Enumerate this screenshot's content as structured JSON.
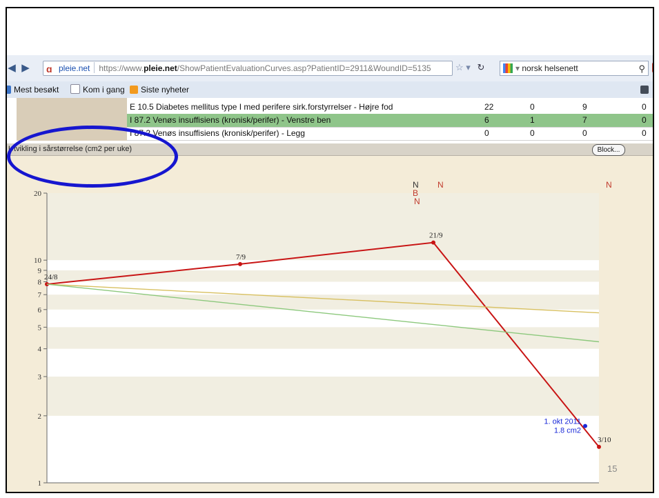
{
  "browser": {
    "site_name": "pleie.net",
    "url_prefix": "https://www.",
    "url_domain": "pleie.net",
    "url_path": "/ShowPatientEvaluationCurves.asp?PatientID=2911&WoundID=5135",
    "search_text": "norsk helsenett",
    "bookmarks": [
      {
        "label": "Mest besøkt"
      },
      {
        "label": "Kom i gang"
      },
      {
        "label": "Siste nyheter"
      }
    ]
  },
  "diagnoses": [
    {
      "label": "E 10.5 Diabetes mellitus type I med perifere sirk.forstyrrelser - Højre fod",
      "c1": "22",
      "c2": "0",
      "c3": "9",
      "c4": "0",
      "selected": false
    },
    {
      "label": "I 87.2 Venøs insuffisiens (kronisk/perifer) - Venstre ben",
      "c1": "6",
      "c2": "1",
      "c3": "7",
      "c4": "0",
      "selected": true
    },
    {
      "label": "I 87.2 Venøs insuffisiens (kronisk/perifer) - Legg",
      "c1": "0",
      "c2": "0",
      "c3": "0",
      "c4": "0",
      "selected": false
    }
  ],
  "panel": {
    "title": "Utvikling i sårstørrelse (cm2 per uke)",
    "block_button": "Block..."
  },
  "chart_data": {
    "type": "line",
    "yscale": "log",
    "ylim": [
      1,
      20
    ],
    "yticks": [
      "1",
      "2",
      "3",
      "4",
      "5",
      "6",
      "7",
      "8",
      "9",
      "10",
      "20"
    ],
    "series": [
      {
        "color": "#c81414",
        "points": [
          {
            "x": "24/8",
            "y": 7.8
          },
          {
            "x": "7/9",
            "y": 9.6
          },
          {
            "x": "21/9",
            "y": 12.0
          },
          {
            "x": "3/10",
            "y": 1.45
          }
        ]
      },
      {
        "color": "#d8c060",
        "points": [
          {
            "x": "24/8",
            "y": 7.8
          },
          {
            "x": "end",
            "y": 5.8
          }
        ]
      },
      {
        "color": "#8cc87c",
        "points": [
          {
            "x": "24/8",
            "y": 7.8
          },
          {
            "x": "end",
            "y": 4.3
          }
        ]
      }
    ],
    "highlight": {
      "label": "1. okt 2011",
      "value": "1.8 cm2",
      "y": 1.8,
      "color": "#1a2ad8"
    },
    "markers": [
      {
        "text": "N",
        "color": "#333333",
        "x": "21/9-left"
      },
      {
        "text": "B",
        "color": "#c0392b",
        "x": "21/9-left"
      },
      {
        "text": "N",
        "color": "#c0392b",
        "x": "21/9-left"
      },
      {
        "text": "N",
        "color": "#c0392b",
        "x": "21/9"
      },
      {
        "text": "N",
        "color": "#c0392b",
        "x": "end"
      }
    ]
  },
  "slide": {
    "page_number": "15"
  },
  "colors": {
    "annotation": "#1616cf",
    "chart_bg": "#f4ecd8",
    "selected_row": "#8fc58a"
  }
}
